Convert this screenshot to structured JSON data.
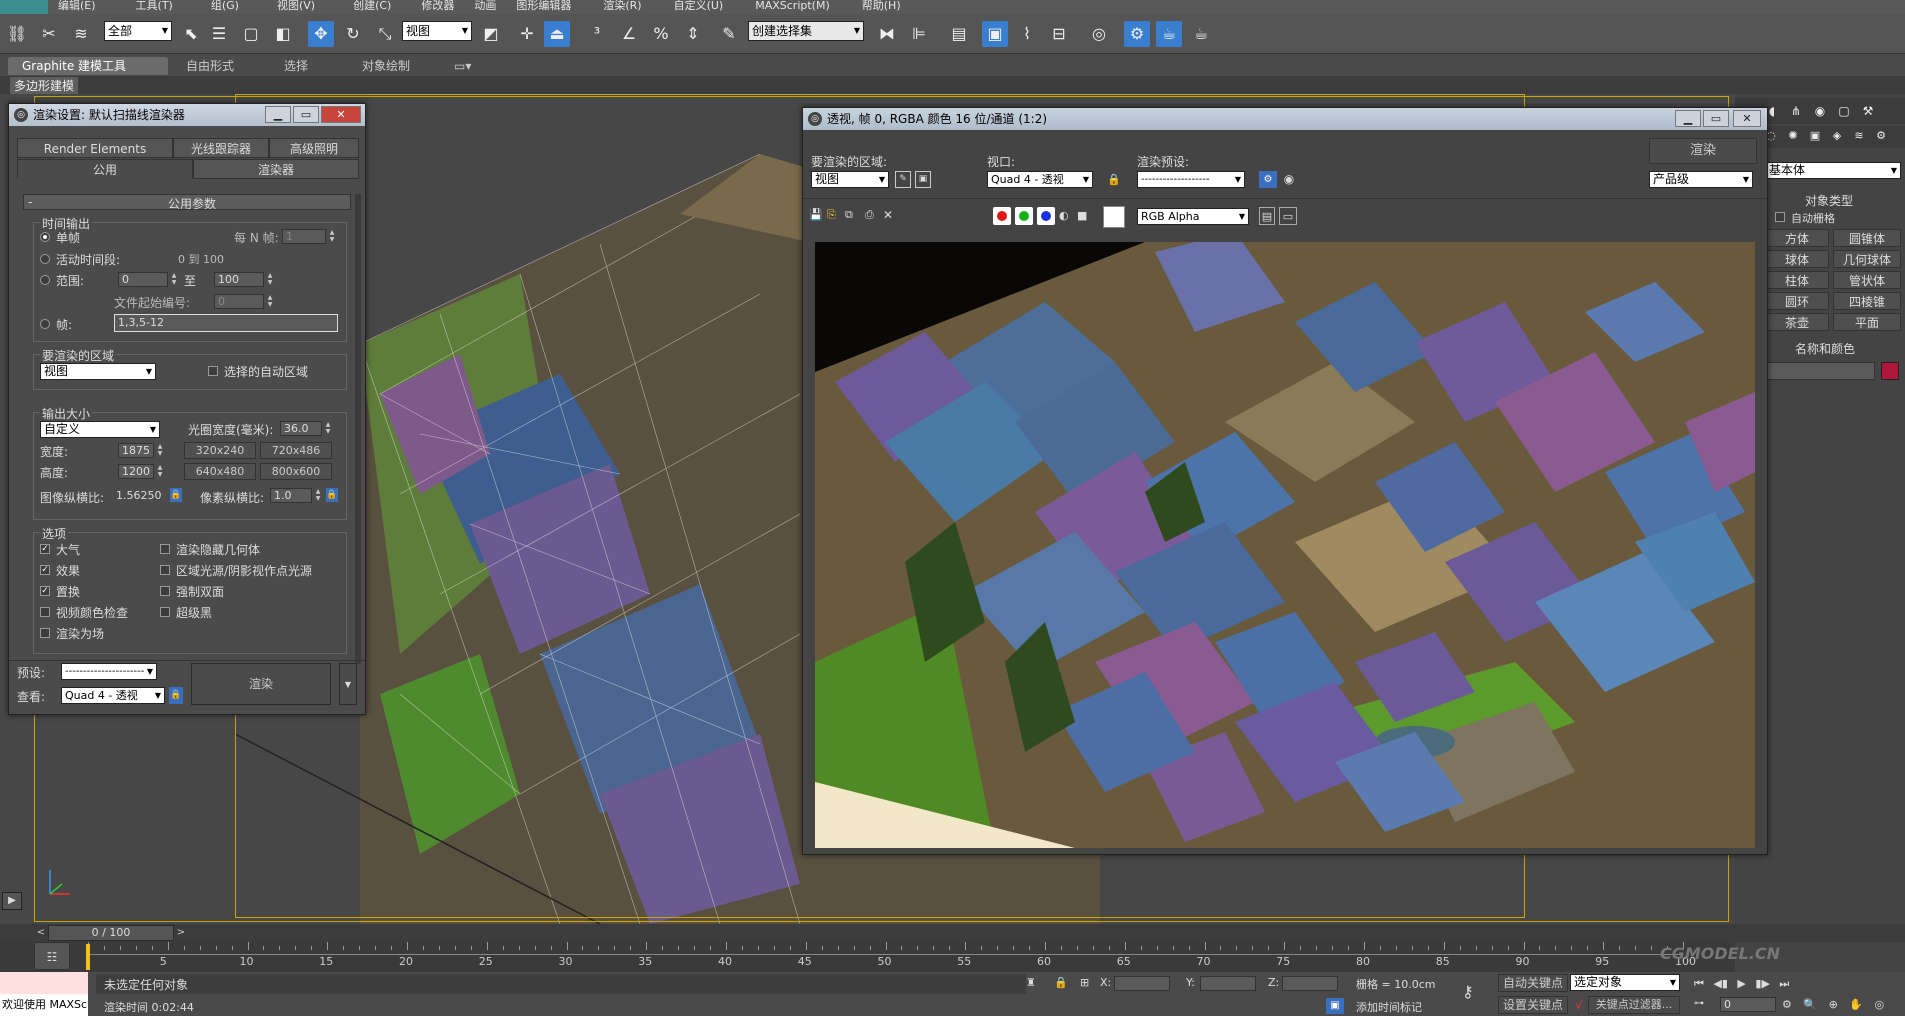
{
  "menubar": {
    "items": [
      "编辑(E)",
      "工具(T)",
      "组(G)",
      "视图(V)",
      "创建(C)",
      "修改器",
      "动画",
      "图形编辑器",
      "渲染(R)",
      "自定义(U)",
      "MAXScript(M)",
      "帮助(H)"
    ]
  },
  "toolbar": {
    "selection_filter": "全部",
    "ref_coord": "视图",
    "named_selection": "创建选择集"
  },
  "ribbon": {
    "tabs": [
      "Graphite 建模工具",
      "自由形式",
      "选择",
      "对象绘制"
    ],
    "sub_label": "多边形建模"
  },
  "render_setup": {
    "title": "渲染设置: 默认扫描线渲染器",
    "tabs_row1": [
      "Render Elements",
      "光线跟踪器",
      "高级照明"
    ],
    "tabs_row2": [
      "公用",
      "渲染器"
    ],
    "rollout": "公用参数",
    "time_output": {
      "title": "时间输出",
      "single": "单帧",
      "every_n": "每 N 帧:",
      "every_n_value": "1",
      "active_segment": "活动时间段:",
      "active_range": "0 到 100",
      "range": "范围:",
      "range_from": "0",
      "to": "至",
      "range_to": "100",
      "file_number": "文件起始编号:",
      "file_number_value": "0",
      "frames": "帧:",
      "frames_value": "1,3,5-12"
    },
    "area": {
      "title": "要渲染的区域",
      "value": "视图",
      "auto_region": "选择的自动区域"
    },
    "output_size": {
      "title": "输出大小",
      "preset": "自定义",
      "aperture_label": "光圈宽度(毫米):",
      "aperture_value": "36.0",
      "width_label": "宽度:",
      "width_value": "1875",
      "height_label": "高度:",
      "height_value": "1200",
      "presets": [
        "320x240",
        "720x486",
        "640x480",
        "800x600"
      ],
      "aspect_label": "图像纵横比:",
      "aspect_value": "1.56250",
      "pixel_aspect_label": "像素纵横比:",
      "pixel_aspect_value": "1.0"
    },
    "options": {
      "title": "选项",
      "left": [
        {
          "label": "大气",
          "checked": true
        },
        {
          "label": "效果",
          "checked": true
        },
        {
          "label": "置换",
          "checked": true
        },
        {
          "label": "视频颜色检查",
          "checked": false
        },
        {
          "label": "渲染为场",
          "checked": false
        }
      ],
      "right": [
        {
          "label": "渲染隐藏几何体",
          "checked": false
        },
        {
          "label": "区域光源/阴影视作点光源",
          "checked": false
        },
        {
          "label": "强制双面",
          "checked": false
        },
        {
          "label": "超级黑",
          "checked": false
        }
      ]
    },
    "preset_label": "预设:",
    "preset_value": "----------------------",
    "view_label": "查看:",
    "view_value": "Quad 4 - 透视",
    "render_button": "渲染"
  },
  "frame_window": {
    "title": "透视, 帧 0, RGBA 颜色 16 位/通道 (1:2)",
    "area_label": "要渲染的区域:",
    "area_value": "视图",
    "viewport_label": "视口:",
    "viewport_value": "Quad 4 - 透视",
    "preset_label": "渲染预设:",
    "preset_value": "-------------------",
    "render_button": "渲染",
    "quality_value": "产品级",
    "channel_value": "RGB Alpha"
  },
  "command_panel": {
    "category": "基本体",
    "object_type": "对象类型",
    "autogrid": "自动栅格",
    "buttons": [
      "方体",
      "圆锥体",
      "球体",
      "几何球体",
      "柱体",
      "管状体",
      "圆环",
      "四棱锥",
      "茶壶",
      "平面"
    ],
    "name_color": "名称和颜色"
  },
  "timeline": {
    "frame_counter": "0 / 100",
    "ticks": [
      "5",
      "10",
      "15",
      "20",
      "25",
      "30",
      "35",
      "40",
      "45",
      "50",
      "55",
      "60",
      "65",
      "70",
      "75",
      "80",
      "85",
      "90",
      "95",
      "100"
    ]
  },
  "status": {
    "maxscript": "欢迎使用 MAXSc",
    "selection": "未选定任何对象",
    "render_time": "渲染时间 0:02:44",
    "x_label": "X:",
    "y_label": "Y:",
    "z_label": "Z:",
    "grid": "栅格 = 10.0cm",
    "auto_key": "自动关键点",
    "set_key": "设置关键点",
    "selected_object": "选定对象",
    "key_filter": "关键点过滤器...",
    "add_time_tag": "添加时间标记",
    "frame_value": "0"
  },
  "watermark": "CGMODEL.CN",
  "colors": {
    "accent_blue": "#3a7fcf",
    "viewport_frame": "#c9a700"
  }
}
